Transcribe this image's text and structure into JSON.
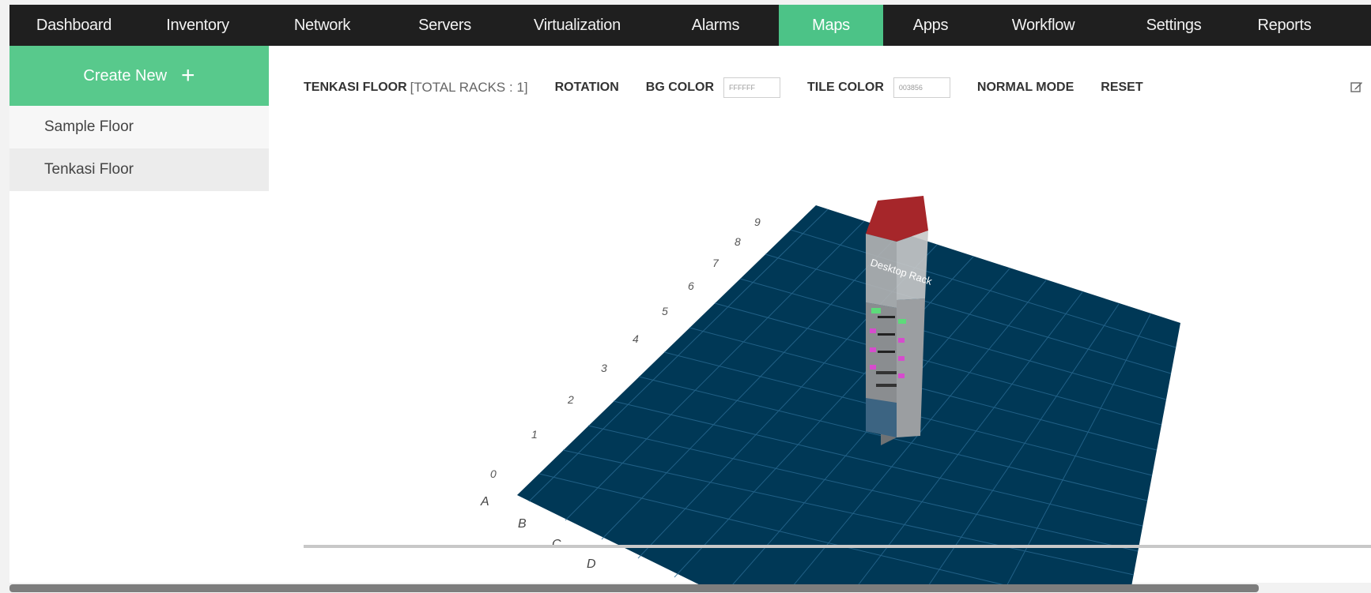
{
  "nav": {
    "items": [
      {
        "label": "Dashboard",
        "active": false
      },
      {
        "label": "Inventory",
        "active": false
      },
      {
        "label": "Network",
        "active": false
      },
      {
        "label": "Servers",
        "active": false
      },
      {
        "label": "Virtualization",
        "active": false
      },
      {
        "label": "Alarms",
        "active": false
      },
      {
        "label": "Maps",
        "active": true
      },
      {
        "label": "Apps",
        "active": false
      },
      {
        "label": "Workflow",
        "active": false
      },
      {
        "label": "Settings",
        "active": false
      },
      {
        "label": "Reports",
        "active": false
      }
    ]
  },
  "sidebar": {
    "create_label": "Create New",
    "create_icon": "plus-icon",
    "floors": [
      "Sample Floor",
      "Tenkasi Floor"
    ],
    "selected_floor": "Tenkasi Floor"
  },
  "toolbar": {
    "floor_name": "TENKASI FLOOR",
    "rack_count": "[TOTAL RACKS : 1]",
    "rotation": "ROTATION",
    "bg_color_label": "BG COLOR",
    "bg_color_value": "FFFFFF",
    "tile_color_label": "TILE COLOR",
    "tile_color_value": "003856",
    "mode": "NORMAL MODE",
    "reset": "RESET",
    "edit_icon": "edit-icon"
  },
  "floor_map": {
    "rack_name": "Desktop Rack",
    "column_labels": [
      "A",
      "B",
      "C",
      "D"
    ],
    "row_labels": [
      "0",
      "1",
      "2",
      "3",
      "4",
      "5",
      "6",
      "7",
      "8",
      "9"
    ],
    "colors": {
      "tile": "#003856",
      "rack_top": "#a6262a",
      "rack_body": "#8e8e8e",
      "grid": "#2a6a92"
    }
  }
}
